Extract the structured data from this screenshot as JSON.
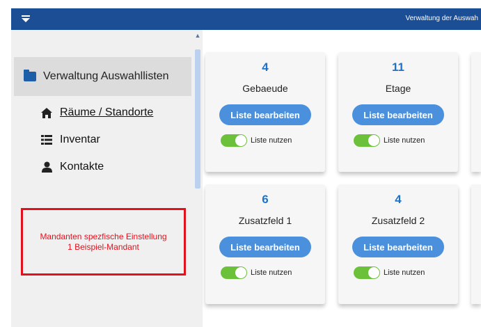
{
  "topbar": {
    "title": "Verwaltung der Auswah",
    "menu_icon": "caret-down-icon"
  },
  "sidebar": {
    "header": {
      "label": "Verwaltung Auswahllisten",
      "icon": "folder-icon"
    },
    "items": [
      {
        "label": "Räume / Standorte",
        "icon": "home-icon",
        "active": true
      },
      {
        "label": "Inventar",
        "icon": "list-icon",
        "active": false
      },
      {
        "label": "Kontakte",
        "icon": "user-icon",
        "active": false
      }
    ],
    "mandant": {
      "line1": "Mandanten spezfische Einstellung",
      "line2": "1 Beispiel-Mandant"
    }
  },
  "cards": [
    {
      "count": "4",
      "name": "Gebaeude",
      "button": "Liste bearbeiten",
      "toggle_label": "Liste nutzen",
      "enabled": true
    },
    {
      "count": "11",
      "name": "Etage",
      "button": "Liste bearbeiten",
      "toggle_label": "Liste nutzen",
      "enabled": true
    },
    {
      "count": "6",
      "name": "Zusatzfeld 1",
      "button": "Liste bearbeiten",
      "toggle_label": "Liste nutzen",
      "enabled": true
    },
    {
      "count": "4",
      "name": "Zusatzfeld 2",
      "button": "Liste bearbeiten",
      "toggle_label": "Liste nutzen",
      "enabled": true
    }
  ],
  "colors": {
    "topbar": "#1c4e96",
    "accent": "#1e73c8",
    "button": "#4a90dc",
    "toggle_on": "#6cc13a",
    "alert": "#e3101d"
  }
}
